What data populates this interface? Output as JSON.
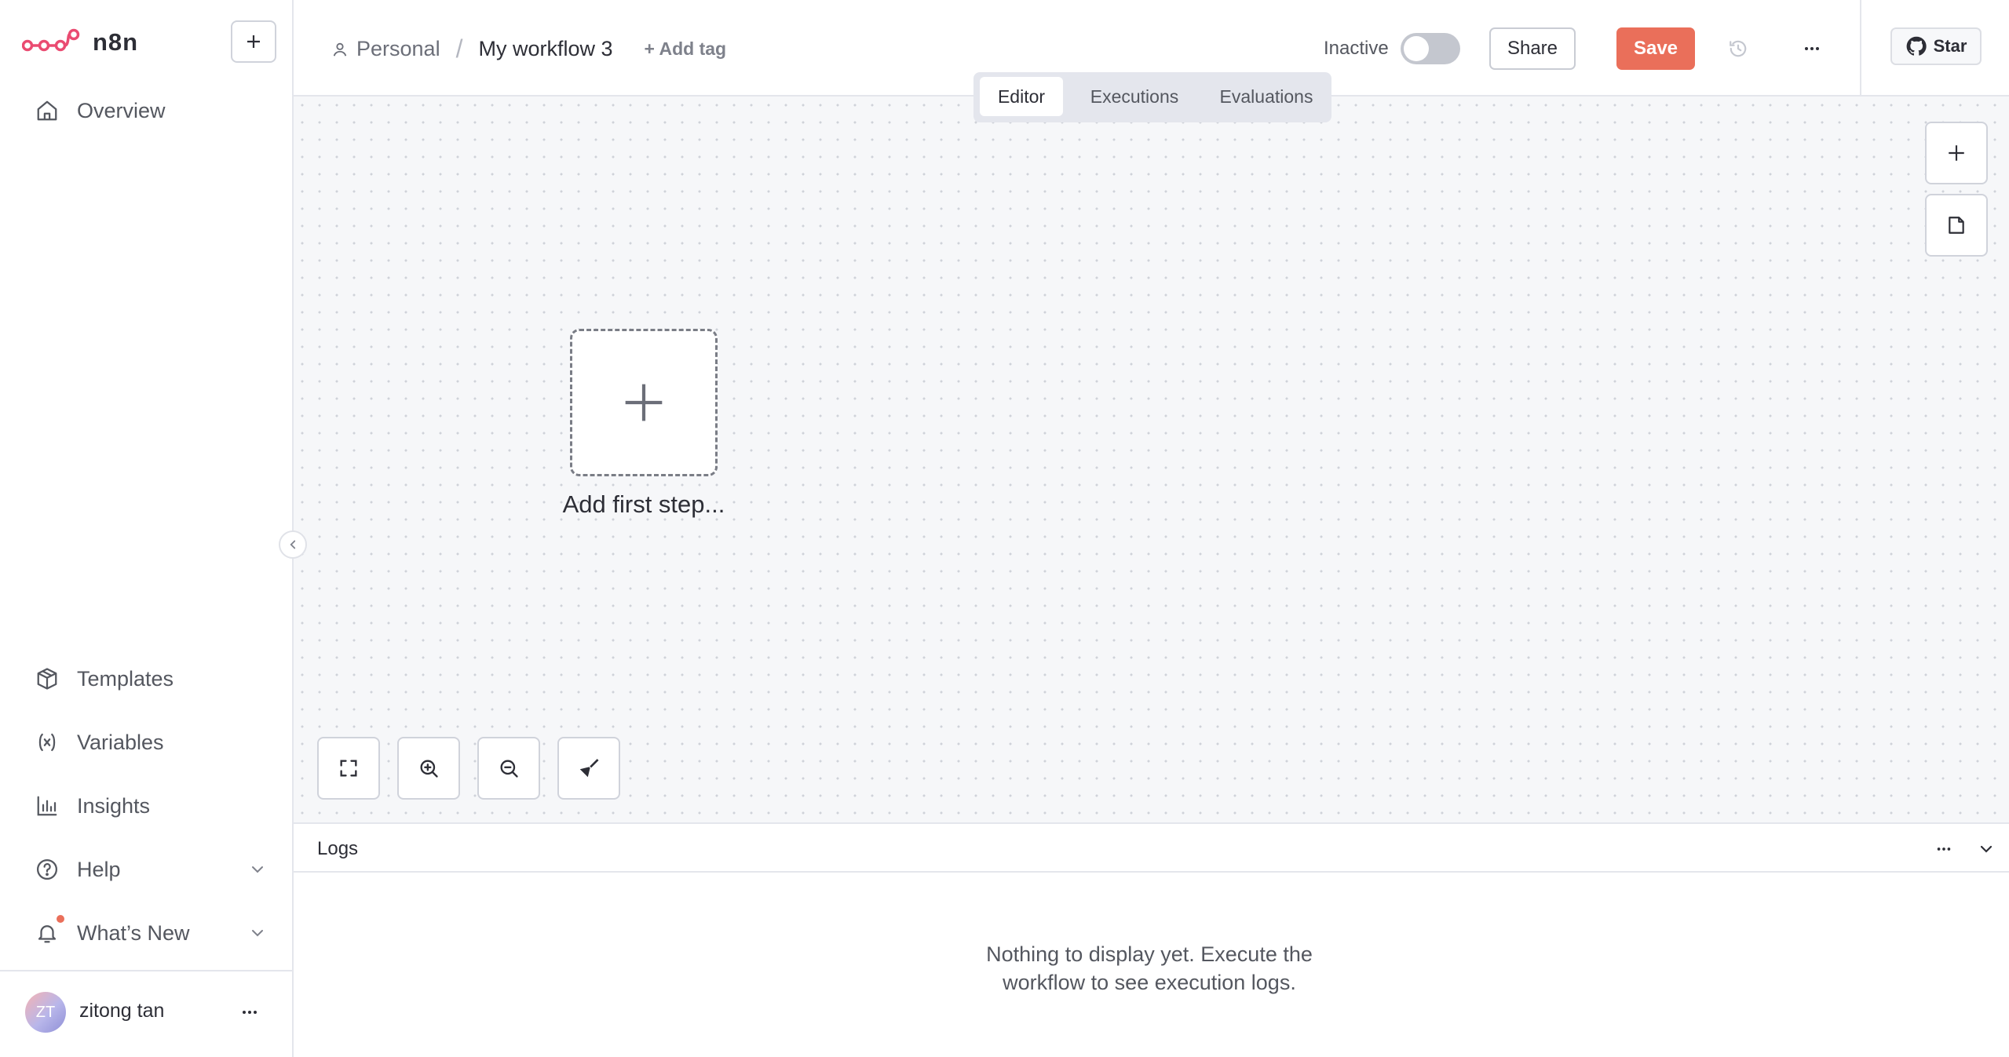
{
  "app": {
    "name": "n8n",
    "brand_color": "#ea4b71",
    "accent_color": "#ea6f5a"
  },
  "sidebar": {
    "logo_text": "n8n",
    "new_button_icon": "plus-icon",
    "top_items": [
      {
        "label": "Overview",
        "icon": "home-icon"
      }
    ],
    "bottom_items": [
      {
        "label": "Templates",
        "icon": "box-icon"
      },
      {
        "label": "Variables",
        "icon": "variable-icon"
      },
      {
        "label": "Insights",
        "icon": "bar-chart-icon"
      },
      {
        "label": "Help",
        "icon": "help-circle-icon",
        "has_chevron": true
      },
      {
        "label": "What’s New",
        "icon": "bell-icon",
        "has_chevron": true,
        "has_notification": true
      }
    ],
    "user": {
      "initials": "ZT",
      "name": "zitong tan"
    }
  },
  "header": {
    "breadcrumb": {
      "project": "Personal",
      "separator": "/",
      "workflow_name": "My workflow 3"
    },
    "add_tag": "+ Add tag",
    "active_label": "Inactive",
    "active": false,
    "share_label": "Share",
    "save_label": "Save",
    "star_label": "Star"
  },
  "tabs": [
    {
      "label": "Editor",
      "active": true
    },
    {
      "label": "Executions",
      "active": false
    },
    {
      "label": "Evaluations",
      "active": false
    }
  ],
  "canvas": {
    "add_first_step_label": "Add first step..."
  },
  "logs": {
    "title": "Logs",
    "empty_line1": "Nothing to display yet. Execute the",
    "empty_line2": "workflow to see execution logs."
  }
}
